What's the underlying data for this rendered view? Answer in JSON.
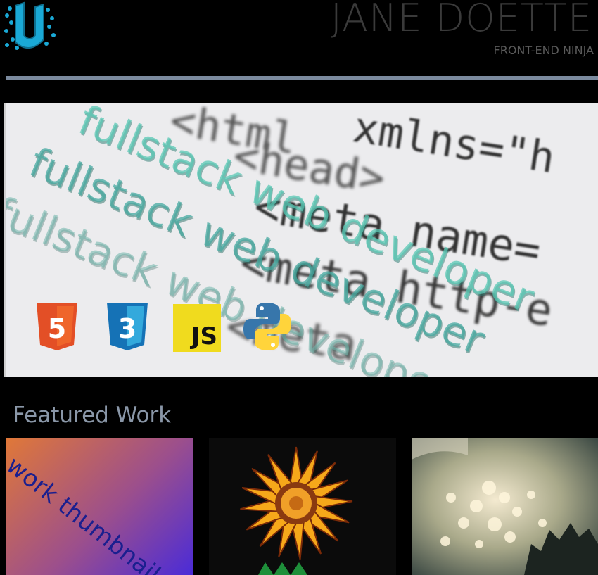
{
  "header": {
    "name": "JANE DOETTE",
    "subtitle": "FRONT-END NINJA",
    "logo_icon": "udacity-logo-icon",
    "colors": {
      "logo": "#1aa9d6",
      "divider": "#7b8a9e"
    }
  },
  "hero": {
    "code_lines": [
      "<html",
      "xmlns=\"h",
      "<head>",
      "<meta name=",
      "<meta http-e",
      "<meta"
    ],
    "banner_text": "fullstack web developer",
    "tech_icons": [
      {
        "name": "html5-icon",
        "label": "5"
      },
      {
        "name": "css3-icon",
        "label": "3"
      },
      {
        "name": "javascript-icon",
        "label": "JS"
      },
      {
        "name": "python-icon"
      }
    ]
  },
  "featured": {
    "title": "Featured Work",
    "items": [
      {
        "kind": "placeholder",
        "label": "work thumbnail"
      },
      {
        "kind": "image",
        "subject": "sunflower"
      },
      {
        "kind": "image",
        "subject": "bokeh-lights"
      }
    ]
  }
}
